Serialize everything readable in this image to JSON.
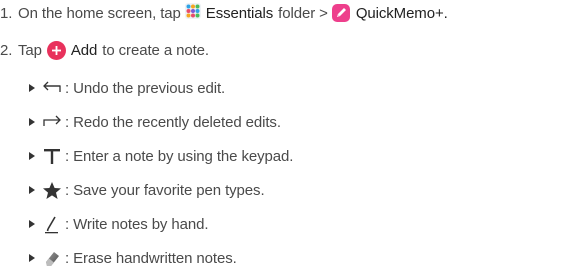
{
  "steps": [
    {
      "number": "1.",
      "pre": "On the home screen, tap",
      "folder_label": "Essentials",
      "mid": "folder >",
      "app_label": "QuickMemo+",
      "end": "."
    },
    {
      "number": "2.",
      "pre": "Tap",
      "button_label": "Add",
      "post": "to create a note."
    }
  ],
  "tools": [
    {
      "icon": "undo-arrow-icon",
      "text": ": Undo the previous edit."
    },
    {
      "icon": "redo-arrow-icon",
      "text": ": Redo the recently deleted edits."
    },
    {
      "icon": "text-t-icon",
      "text": ": Enter a note by using the keypad."
    },
    {
      "icon": "star-icon",
      "text": ": Save your favorite pen types."
    },
    {
      "icon": "pen-icon",
      "text": ": Write notes by hand."
    },
    {
      "icon": "eraser-icon",
      "text": ": Erase handwritten notes."
    }
  ],
  "colors": {
    "body_text": "#4a4a4a",
    "emphasis_text": "#222222",
    "quickmemo_pink": "#ee3f8c",
    "add_red": "#e8315c",
    "icon_dark": "#333333"
  }
}
